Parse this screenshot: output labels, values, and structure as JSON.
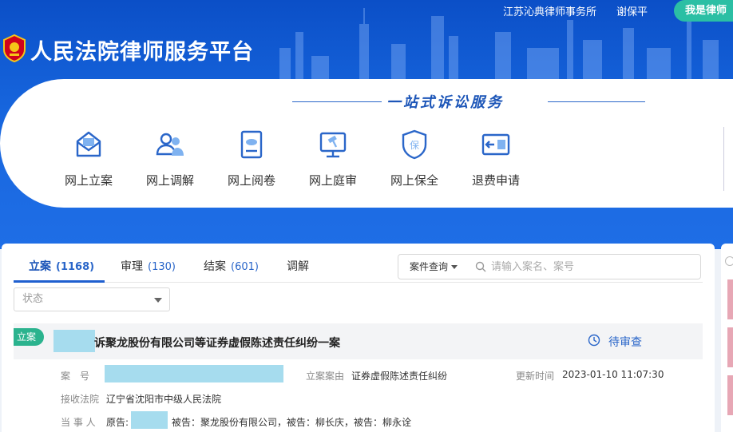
{
  "header": {
    "org": "江苏沁典律师事务所",
    "user": "谢保平",
    "role_button": "我是律师",
    "site_title": "人民法院律师服务平台"
  },
  "services": {
    "slogan": "一站式诉讼服务",
    "items": [
      {
        "label": "网上立案",
        "icon": "envelope-icon"
      },
      {
        "label": "网上调解",
        "icon": "users-icon"
      },
      {
        "label": "网上阅卷",
        "icon": "document-eye-icon"
      },
      {
        "label": "网上庭审",
        "icon": "gavel-monitor-icon"
      },
      {
        "label": "网上保全",
        "icon": "shield-bao-icon"
      },
      {
        "label": "退费申请",
        "icon": "refund-card-icon"
      }
    ]
  },
  "tabs": [
    {
      "label": "立案",
      "count": "(1168)"
    },
    {
      "label": "审理",
      "count": "(130)"
    },
    {
      "label": "结案",
      "count": "(601)"
    },
    {
      "label": "调解",
      "count": ""
    }
  ],
  "search": {
    "query_type": "案件查询",
    "placeholder": "请输入案名、案号",
    "status_placeholder": "状态"
  },
  "case": {
    "badge": "立案",
    "title": "诉聚龙股份有限公司等证券虚假陈述责任纠纷一案",
    "status": "待审查",
    "case_no_label": "案　号",
    "cause_label": "立案案由",
    "cause": "证券虚假陈述责任纠纷",
    "updated_label": "更新时间",
    "updated": "2023-01-10 11:07:30",
    "court_label": "接收法院",
    "court": "辽宁省沈阳市中级人民法院",
    "parties_label": "当 事 人",
    "plaintiff_label": "原告:",
    "defendants": "被告：聚龙股份有限公司，被告：柳长庆，被告：柳永诠"
  },
  "colors": {
    "primary": "#1f5fcf",
    "accent_green": "#2bbfa4",
    "redaction": "#a6dcee"
  }
}
